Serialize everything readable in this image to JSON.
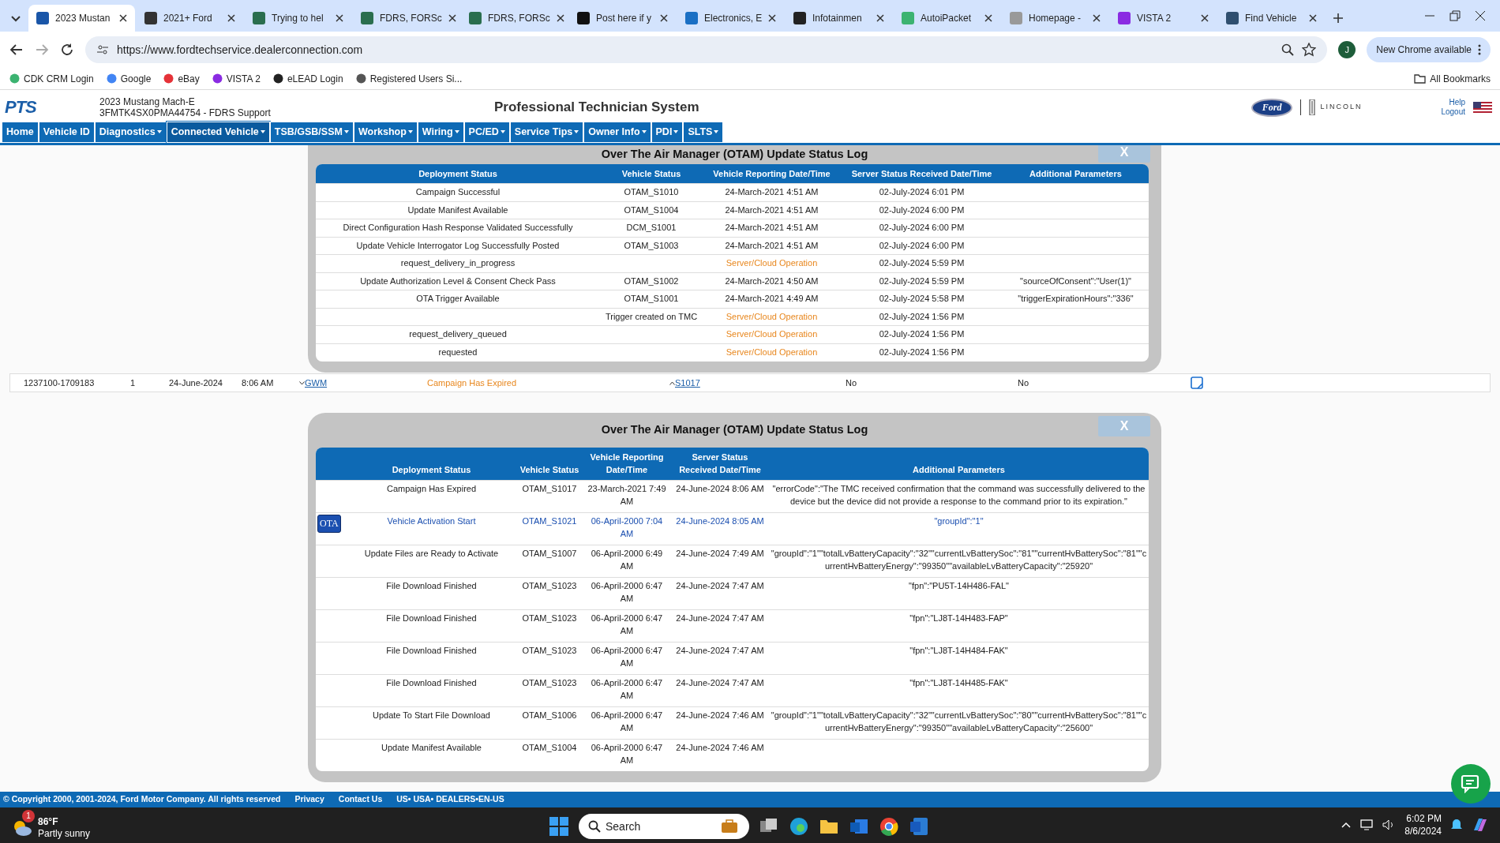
{
  "browser": {
    "tabs": [
      {
        "title": "2023 Mustan",
        "selected": true,
        "color": "#1a56a8"
      },
      {
        "title": "2021+ Ford",
        "selected": false,
        "color": "#333333"
      },
      {
        "title": "Trying to hel",
        "selected": false,
        "color": "#2a6e4e"
      },
      {
        "title": "FDRS, FORSc",
        "selected": false,
        "color": "#2a6e4e"
      },
      {
        "title": "FDRS, FORSc",
        "selected": false,
        "color": "#2a6e4e"
      },
      {
        "title": "Post here if y",
        "selected": false,
        "color": "#111111"
      },
      {
        "title": "Electronics, E",
        "selected": false,
        "color": "#1a6fc4"
      },
      {
        "title": "Infotainmen",
        "selected": false,
        "color": "#222222"
      },
      {
        "title": "AutoiPacket",
        "selected": false,
        "color": "#3cb371"
      },
      {
        "title": "Homepage -",
        "selected": false,
        "color": "#999999"
      },
      {
        "title": "VISTA 2",
        "selected": false,
        "color": "#8a2be2"
      },
      {
        "title": "Find Vehicle",
        "selected": false,
        "color": "#2f4f6f"
      }
    ],
    "address": "https://www.fordtechservice.dealerconnection.com",
    "profile": "J",
    "update_button": "New Chrome available",
    "bookmarks": [
      "CDK CRM Login",
      "Google",
      "eBay",
      "VISTA 2",
      "eLEAD Login",
      "Registered Users Si..."
    ],
    "all_bookmarks": "All Bookmarks"
  },
  "header": {
    "logo": "PTS",
    "vehicle_model": "2023 Mustang Mach-E",
    "vin_line": "3FMTK4SX0PMA44754 - FDRS Support",
    "title": "Professional Technician System",
    "ford_logo": "Ford",
    "lincoln_logo": "LINCOLN",
    "links": [
      "Help",
      "Logout"
    ]
  },
  "nav": [
    {
      "label": "Home",
      "dropdown": false,
      "selected": false
    },
    {
      "label": "Vehicle ID",
      "dropdown": false,
      "selected": false
    },
    {
      "label": "Diagnostics",
      "dropdown": true,
      "selected": false
    },
    {
      "label": "Connected Vehicle",
      "dropdown": true,
      "selected": true
    },
    {
      "label": "TSB/GSB/SSM",
      "dropdown": true,
      "selected": false
    },
    {
      "label": "Workshop",
      "dropdown": true,
      "selected": false
    },
    {
      "label": "Wiring",
      "dropdown": true,
      "selected": false
    },
    {
      "label": "PC/ED",
      "dropdown": true,
      "selected": false
    },
    {
      "label": "Service Tips",
      "dropdown": true,
      "selected": false
    },
    {
      "label": "Owner Info",
      "dropdown": true,
      "selected": false
    },
    {
      "label": "PDI",
      "dropdown": true,
      "selected": false
    },
    {
      "label": "SLTS",
      "dropdown": true,
      "selected": false
    }
  ],
  "otam_log_upper": {
    "title": "Over The Air Manager (OTAM) Update Status Log",
    "close": "X",
    "columns": [
      "Deployment Status",
      "Vehicle Status",
      "Vehicle Reporting Date/Time",
      "Server Status Received Date/Time",
      "Additional Parameters"
    ],
    "rows": [
      {
        "kind": "vehicle",
        "cells": [
          "Campaign Successful",
          "OTAM_S1010",
          "24-March-2021 4:51 AM",
          "02-July-2024 6:01 PM",
          ""
        ]
      },
      {
        "kind": "vehicle",
        "cells": [
          "Update Manifest Available",
          "OTAM_S1004",
          "24-March-2021 4:51 AM",
          "02-July-2024 6:00 PM",
          ""
        ]
      },
      {
        "kind": "vehicle",
        "cells": [
          "Direct Configuration Hash Response Validated Successfully",
          "DCM_S1001",
          "24-March-2021 4:51 AM",
          "02-July-2024 6:00 PM",
          ""
        ]
      },
      {
        "kind": "vehicle",
        "cells": [
          "Update Vehicle Interrogator Log Successfully Posted",
          "OTAM_S1003",
          "24-March-2021 4:51 AM",
          "02-July-2024 6:00 PM",
          ""
        ]
      },
      {
        "kind": "cloud",
        "cells": [
          "request_delivery_in_progress",
          "",
          "Server/Cloud Operation",
          "02-July-2024 5:59 PM",
          ""
        ]
      },
      {
        "kind": "vehicle",
        "cells": [
          "Update Authorization Level & Consent Check Pass",
          "OTAM_S1002",
          "24-March-2021 4:50 AM",
          "02-July-2024 5:59 PM",
          "\"sourceOfConsent\":\"User(1)\""
        ]
      },
      {
        "kind": "vehicle",
        "cells": [
          "OTA Trigger Available",
          "OTAM_S1001",
          "24-March-2021 4:49 AM",
          "02-July-2024 5:58 PM",
          "\"triggerExpirationHours\":\"336\""
        ]
      },
      {
        "kind": "cloud",
        "cells": [
          "",
          "Trigger created on TMC",
          "Server/Cloud Operation",
          "02-July-2024 1:56 PM",
          ""
        ]
      },
      {
        "kind": "cloud",
        "cells": [
          "request_delivery_queued",
          "",
          "Server/Cloud Operation",
          "02-July-2024 1:56 PM",
          ""
        ]
      },
      {
        "kind": "cloud",
        "cells": [
          "requested",
          "",
          "Server/Cloud Operation",
          "02-July-2024 1:56 PM",
          ""
        ]
      }
    ]
  },
  "campaign_row": {
    "id": "1237100-1709183",
    "count": "1",
    "date": "24-June-2024",
    "time": "8:06 AM",
    "source": {
      "label": "GWM",
      "expanded": false
    },
    "status": {
      "text": "Campaign Has Expired",
      "kind": "expired"
    },
    "code": {
      "label": "S1017",
      "expanded": true
    },
    "column_8": "No",
    "column_9": "No"
  },
  "otam_log_lower": {
    "title": "Over The Air Manager (OTAM) Update Status Log",
    "close": "X",
    "columns": [
      "Deployment Status",
      "Vehicle Status",
      "Vehicle Reporting Date/Time",
      "Server Status Received Date/Time",
      "Additional Parameters"
    ],
    "rows": [
      {
        "badge": "",
        "highlighted": false,
        "cells": [
          "Campaign Has Expired",
          "OTAM_S1017",
          "23-March-2021 7:49 AM",
          "24-June-2024 8:06 AM",
          "\"errorCode\":\"The TMC received confirmation that the command was successfully delivered to the device but the device did not provide a response to the command prior to its expiration.\""
        ]
      },
      {
        "badge": "OTA",
        "highlighted": true,
        "cells": [
          "Vehicle Activation Start",
          "OTAM_S1021",
          "06-April-2000 7:04 AM",
          "24-June-2024 8:05 AM",
          "\"groupId\":\"1\""
        ]
      },
      {
        "badge": "",
        "highlighted": false,
        "cells": [
          "Update Files are Ready to Activate",
          "OTAM_S1007",
          "06-April-2000 6:49 AM",
          "24-June-2024 7:49 AM",
          "\"groupId\":\"1\"\"totalLvBatteryCapacity\":\"32\"\"currentLvBatterySoc\":\"81\"\"currentHvBatterySoc\":\"81\"\"currentHvBatteryEnergy\":\"99350\"\"availableLvBatteryCapacity\":\"25920\""
        ]
      },
      {
        "badge": "",
        "highlighted": false,
        "cells": [
          "File Download Finished",
          "OTAM_S1023",
          "06-April-2000 6:47 AM",
          "24-June-2024 7:47 AM",
          "\"fpn\":\"PU5T-14H486-FAL\""
        ]
      },
      {
        "badge": "",
        "highlighted": false,
        "cells": [
          "File Download Finished",
          "OTAM_S1023",
          "06-April-2000 6:47 AM",
          "24-June-2024 7:47 AM",
          "\"fpn\":\"LJ8T-14H483-FAP\""
        ]
      },
      {
        "badge": "",
        "highlighted": false,
        "cells": [
          "File Download Finished",
          "OTAM_S1023",
          "06-April-2000 6:47 AM",
          "24-June-2024 7:47 AM",
          "\"fpn\":\"LJ8T-14H484-FAK\""
        ]
      },
      {
        "badge": "",
        "highlighted": false,
        "cells": [
          "File Download Finished",
          "OTAM_S1023",
          "06-April-2000 6:47 AM",
          "24-June-2024 7:47 AM",
          "\"fpn\":\"LJ8T-14H485-FAK\""
        ]
      },
      {
        "badge": "",
        "highlighted": false,
        "cells": [
          "Update To Start File Download",
          "OTAM_S1006",
          "06-April-2000 6:47 AM",
          "24-June-2024 7:46 AM",
          "\"groupId\":\"1\"\"totalLvBatteryCapacity\":\"32\"\"currentLvBatterySoc\":\"80\"\"currentHvBatterySoc\":\"81\"\"currentHvBatteryEnergy\":\"99350\"\"availableLvBatteryCapacity\":\"25600\""
        ]
      },
      {
        "badge": "",
        "highlighted": false,
        "cells": [
          "Update Manifest Available",
          "OTAM_S1004",
          "06-April-2000 6:47 AM",
          "24-June-2024 7:46 AM",
          ""
        ]
      }
    ]
  },
  "footer": {
    "copyright": "© Copyright 2000, 2001-2024, Ford Motor Company. All rights reserved",
    "links": [
      "Privacy",
      "Contact Us"
    ],
    "locale": "US• USA• DEALERS•EN-US"
  },
  "taskbar": {
    "weather_badge": "1",
    "weather_temp": "86°F",
    "weather_text": "Partly sunny",
    "search_placeholder": "Search",
    "time": "6:02 PM",
    "date": "8/6/2024"
  }
}
